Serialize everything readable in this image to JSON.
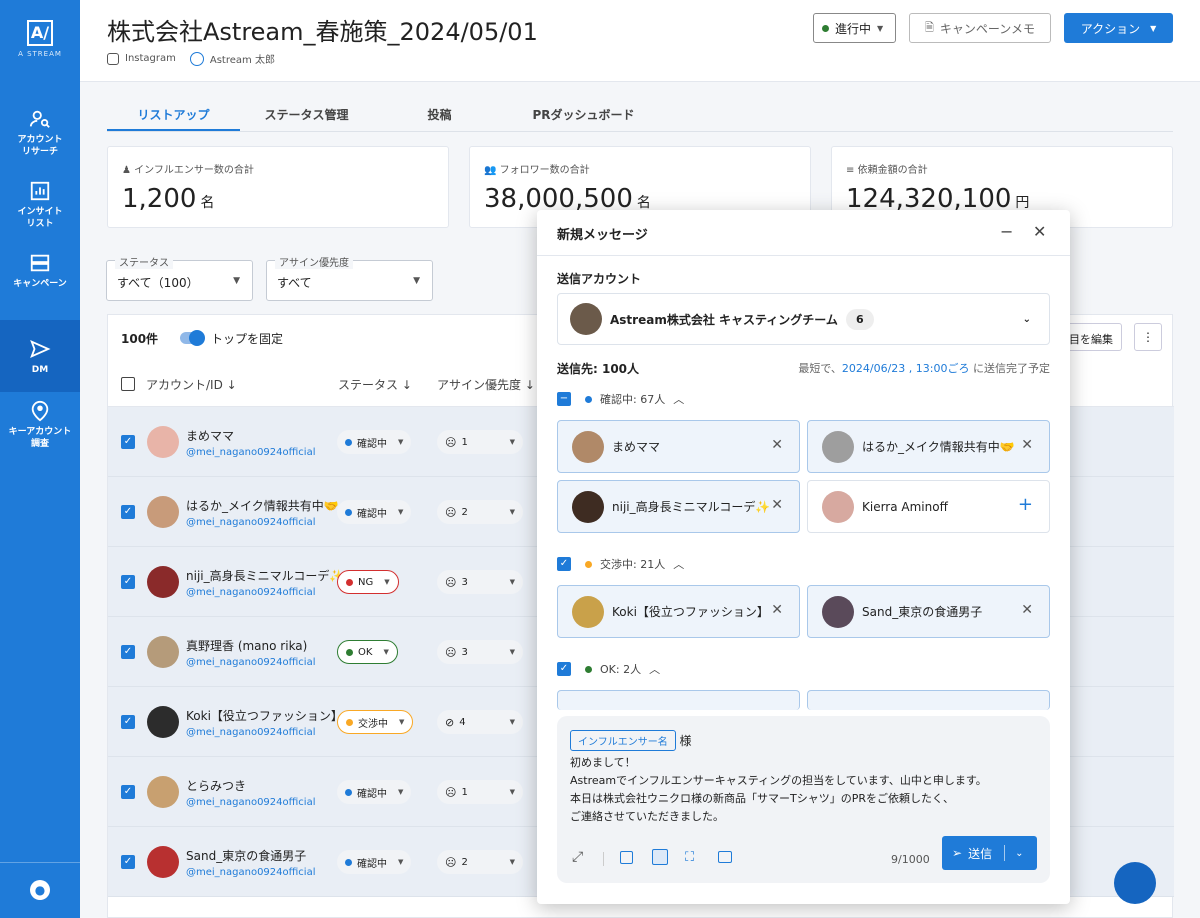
{
  "sidebar": {
    "logo_text": "A STREAM",
    "items": [
      {
        "label": "アカウント\nリサーチ",
        "icon": "person-search-icon"
      },
      {
        "label": "インサイト\nリスト",
        "icon": "chart-icon"
      },
      {
        "label": "キャンペーン",
        "icon": "server-icon"
      },
      {
        "label": "DM",
        "icon": "send-icon"
      },
      {
        "label": "キーアカウント\n調査",
        "icon": "location-person-icon"
      }
    ]
  },
  "header": {
    "title": "株式会社Astream_春施策_2024/05/01",
    "platform": "Instagram",
    "owner": "Astream 太郎",
    "status": "進行中",
    "memo": "キャンペーンメモ",
    "action": "アクション",
    "status_color": "#2e7d32"
  },
  "tabs": [
    "リストアップ",
    "ステータス管理",
    "投稿",
    "PRダッシュボード"
  ],
  "cards": [
    {
      "label": "インフルエンサー数の合計",
      "value": "1,200",
      "unit": "名"
    },
    {
      "label": "フォロワー数の合計",
      "value": "38,000,500",
      "unit": "名"
    },
    {
      "label": "依頼金額の合計",
      "value": "124,320,100",
      "unit": "円"
    }
  ],
  "filters": [
    {
      "label": "ステータス",
      "value": "すべて（100）"
    },
    {
      "label": "アサイン優先度",
      "value": "すべて"
    }
  ],
  "table": {
    "count": "100件",
    "pin_label": "トップを固定",
    "edit_cols": "項目を編集",
    "col_account": "アカウント/ID",
    "col_status": "ステータス",
    "col_priority": "アサイン優先度",
    "rows": [
      {
        "name": "まめママ",
        "id": "@mei_nagano0924official",
        "status": "確認中",
        "priority": "1",
        "color": "#1f7bd8",
        "prio_icon": "neutral-face-icon"
      },
      {
        "name": "はるか_メイク情報共有中🤝",
        "id": "@mei_nagano0924official",
        "status": "確認中",
        "priority": "2",
        "color": "#1f7bd8",
        "prio_icon": "neutral-face-icon"
      },
      {
        "name": "niji_高身長ミニマルコーデ✨",
        "id": "@mei_nagano0924official",
        "status": "NG",
        "priority": "3",
        "color": "#d32f2f",
        "prio_icon": "neutral-face-icon"
      },
      {
        "name": "真野理香 (mano rika)",
        "id": "@mei_nagano0924official",
        "status": "OK",
        "priority": "3",
        "color": "#2e7d32",
        "prio_icon": "neutral-face-icon"
      },
      {
        "name": "Koki【役立つファッション】",
        "id": "@mei_nagano0924official",
        "status": "交渉中",
        "priority": "4",
        "color": "#f9a825",
        "prio_icon": "block-icon"
      },
      {
        "name": "とらみつき",
        "id": "@mei_nagano0924official",
        "status": "確認中",
        "priority": "1",
        "color": "#1f7bd8",
        "prio_icon": "neutral-face-icon"
      },
      {
        "name": "Sand_東京の食通男子",
        "id": "@mei_nagano0924official",
        "status": "確認中",
        "priority": "2",
        "color": "#1f7bd8",
        "prio_icon": "neutral-face-icon"
      }
    ]
  },
  "modal": {
    "title": "新規メッセージ",
    "account_label": "送信アカウント",
    "account_name": "Astream株式会社 キャスティングチーム",
    "account_count": "6",
    "recipients": "送信先: 100人",
    "schedule_prefix": "最短で、",
    "schedule_date": "2024/06/23 , 13:00ごろ",
    "schedule_suffix": " に送信完了予定",
    "groups": [
      {
        "label": "確認中: 67人",
        "color": "#1f7bd8",
        "checked": "partial",
        "chips": [
          {
            "name": "まめママ",
            "sel": true
          },
          {
            "name": "はるか_メイク情報共有中🤝",
            "sel": true
          },
          {
            "name": "niji_高身長ミニマルコーデ✨",
            "sel": true
          },
          {
            "name": "Kierra Aminoff",
            "sel": false
          }
        ]
      },
      {
        "label": "交渉中: 21人",
        "color": "#f9a825",
        "checked": "true",
        "chips": [
          {
            "name": "Koki【役立つファッション】",
            "sel": true
          },
          {
            "name": "Sand_東京の食通男子",
            "sel": true
          }
        ]
      },
      {
        "label": "OK: 2人",
        "color": "#2e7d32",
        "checked": "true",
        "chips": []
      }
    ],
    "tag": "インフルエンサー名",
    "sama": "様",
    "body": [
      "初めまして！",
      "Astreamでインフルエンサーキャスティングの担当をしています、山中と申します。",
      "本日は株式会社ウニクロ様の新商品「サマーTシャツ」のPRをご依頼したく、",
      "ご連絡させていただきました。"
    ],
    "char_count": "9/1000",
    "send": "送信"
  }
}
